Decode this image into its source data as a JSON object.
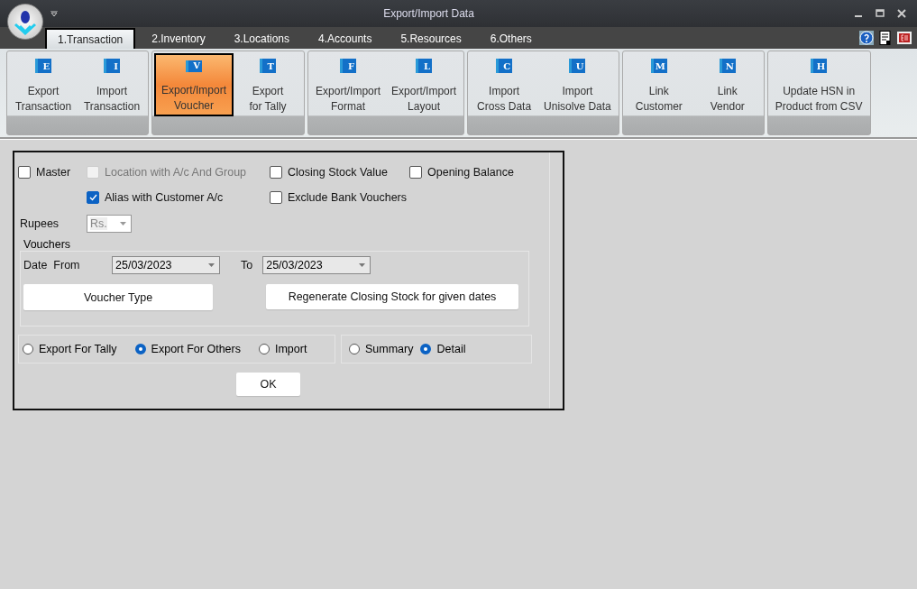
{
  "window": {
    "title": "Export/Import Data"
  },
  "tabs": [
    {
      "label": "1.Transaction",
      "selected": true
    },
    {
      "label": "2.Inventory",
      "selected": false
    },
    {
      "label": "3.Locations",
      "selected": false
    },
    {
      "label": "4.Accounts",
      "selected": false
    },
    {
      "label": "5.Resources",
      "selected": false
    },
    {
      "label": "6.Others",
      "selected": false
    }
  ],
  "ribbon": {
    "groups": [
      {
        "buttons": [
          {
            "icon_letter": "E",
            "label": "Export\nTransaction",
            "selected": false
          },
          {
            "icon_letter": "I",
            "label": "Import\nTransaction",
            "selected": false
          }
        ]
      },
      {
        "buttons": [
          {
            "icon_letter": "V",
            "label": "Export/Import\nVoucher",
            "selected": true
          },
          {
            "icon_letter": "T",
            "label": "Export\nfor Tally",
            "selected": false
          }
        ]
      },
      {
        "buttons": [
          {
            "icon_letter": "F",
            "label": "Export/Import\nFormat",
            "selected": false
          },
          {
            "icon_letter": "L",
            "label": "Export/Import\nLayout",
            "selected": false
          }
        ]
      },
      {
        "buttons": [
          {
            "icon_letter": "C",
            "label": "Import\nCross Data",
            "selected": false
          },
          {
            "icon_letter": "U",
            "label": "Import\nUnisolve Data",
            "selected": false
          }
        ]
      },
      {
        "buttons": [
          {
            "icon_letter": "M",
            "label": "Link\nCustomer",
            "selected": false
          },
          {
            "icon_letter": "N",
            "label": "Link\nVendor",
            "selected": false
          }
        ]
      },
      {
        "buttons": [
          {
            "icon_letter": "H",
            "label": "Update HSN in\nProduct from CSV",
            "selected": false
          }
        ]
      }
    ]
  },
  "form": {
    "checkboxes_row1": [
      {
        "label": "Master",
        "checked": false,
        "disabled": false
      },
      {
        "label": "Location with A/c And Group",
        "checked": false,
        "disabled": true
      },
      {
        "label": "Closing Stock Value",
        "checked": false,
        "disabled": false
      },
      {
        "label": "Opening Balance",
        "checked": false,
        "disabled": false
      }
    ],
    "checkboxes_row2": [
      {
        "label": "Alias with Customer A/c",
        "checked": true,
        "disabled": false
      },
      {
        "label": "Exclude Bank Vouchers",
        "checked": false,
        "disabled": false
      }
    ],
    "rupees": {
      "label": "Rupees",
      "value": "Rs.",
      "disabled": true
    },
    "vouchers": {
      "title": "Vouchers",
      "date_from_label": "Date  From",
      "date_from": "25/03/2023",
      "to_label": "To",
      "date_to": "25/03/2023",
      "voucher_type_button": "Voucher Type",
      "regenerate_button": "Regenerate Closing Stock for given dates"
    },
    "mode_options": [
      {
        "label": "Export For Tally",
        "selected": false
      },
      {
        "label": "Export For Others",
        "selected": true
      },
      {
        "label": "Import",
        "selected": false
      }
    ],
    "detail_options": [
      {
        "label": "Summary",
        "selected": false
      },
      {
        "label": "Detail",
        "selected": true
      }
    ],
    "ok_button": "OK"
  }
}
